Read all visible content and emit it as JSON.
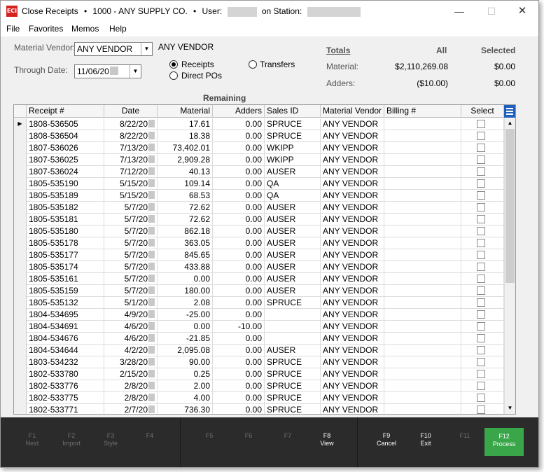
{
  "window": {
    "logo": "ECI",
    "title": "Close Receipts",
    "bullet": "•",
    "company": "1000 - ANY SUPPLY CO.",
    "user_label": "User:",
    "station_label": "on Station:",
    "min_glyph": "—",
    "max_glyph": "☐",
    "close_glyph": "✕"
  },
  "menu": [
    "File",
    "Favorites",
    "Memos",
    "Help"
  ],
  "filters": {
    "vendor_label": "Material Vendor:",
    "vendor_value": "ANY VENDOR",
    "vendor_name": "ANY VENDOR",
    "date_label": "Through Date:",
    "date_value": "11/06/20",
    "radios": [
      {
        "label": "Receipts",
        "checked": true
      },
      {
        "label": "Direct POs",
        "checked": false
      },
      {
        "label": "Transfers",
        "checked": false
      }
    ]
  },
  "totals": {
    "heading": "Totals",
    "col_all": "All",
    "col_selected": "Selected",
    "rows": [
      {
        "label": "Material:",
        "all": "$2,110,269.08",
        "selected": "$0.00"
      },
      {
        "label": "Adders:",
        "all": "($10.00)",
        "selected": "$0.00"
      }
    ]
  },
  "grid": {
    "group_header": "Remaining",
    "columns": [
      "Receipt #",
      "Date",
      "Material",
      "Adders",
      "Sales ID",
      "Material Vendor",
      "Billing #",
      "Select"
    ],
    "current_row_marker": "▶",
    "scroll_up": "▲",
    "scroll_down": "▼",
    "rows": [
      {
        "receipt": "1808-536505",
        "date": "8/22/20",
        "material": "17.61",
        "adders": "0.00",
        "sales_id": "SPRUCE",
        "vendor": "ANY VENDOR",
        "billing": ""
      },
      {
        "receipt": "1808-536504",
        "date": "8/22/20",
        "material": "18.38",
        "adders": "0.00",
        "sales_id": "SPRUCE",
        "vendor": "ANY VENDOR",
        "billing": ""
      },
      {
        "receipt": "1807-536026",
        "date": "7/13/20",
        "material": "73,402.01",
        "adders": "0.00",
        "sales_id": "WKIPP",
        "vendor": "ANY VENDOR",
        "billing": ""
      },
      {
        "receipt": "1807-536025",
        "date": "7/13/20",
        "material": "2,909.28",
        "adders": "0.00",
        "sales_id": "WKIPP",
        "vendor": "ANY VENDOR",
        "billing": ""
      },
      {
        "receipt": "1807-536024",
        "date": "7/12/20",
        "material": "40.13",
        "adders": "0.00",
        "sales_id": "AUSER",
        "vendor": "ANY VENDOR",
        "billing": ""
      },
      {
        "receipt": "1805-535190",
        "date": "5/15/20",
        "material": "109.14",
        "adders": "0.00",
        "sales_id": "QA",
        "vendor": "ANY VENDOR",
        "billing": ""
      },
      {
        "receipt": "1805-535189",
        "date": "5/15/20",
        "material": "68.53",
        "adders": "0.00",
        "sales_id": "QA",
        "vendor": "ANY VENDOR",
        "billing": ""
      },
      {
        "receipt": "1805-535182",
        "date": "5/7/20",
        "material": "72.62",
        "adders": "0.00",
        "sales_id": "AUSER",
        "vendor": "ANY VENDOR",
        "billing": ""
      },
      {
        "receipt": "1805-535181",
        "date": "5/7/20",
        "material": "72.62",
        "adders": "0.00",
        "sales_id": "AUSER",
        "vendor": "ANY VENDOR",
        "billing": ""
      },
      {
        "receipt": "1805-535180",
        "date": "5/7/20",
        "material": "862.18",
        "adders": "0.00",
        "sales_id": "AUSER",
        "vendor": "ANY VENDOR",
        "billing": ""
      },
      {
        "receipt": "1805-535178",
        "date": "5/7/20",
        "material": "363.05",
        "adders": "0.00",
        "sales_id": "AUSER",
        "vendor": "ANY VENDOR",
        "billing": ""
      },
      {
        "receipt": "1805-535177",
        "date": "5/7/20",
        "material": "845.65",
        "adders": "0.00",
        "sales_id": "AUSER",
        "vendor": "ANY VENDOR",
        "billing": ""
      },
      {
        "receipt": "1805-535174",
        "date": "5/7/20",
        "material": "433.88",
        "adders": "0.00",
        "sales_id": "AUSER",
        "vendor": "ANY VENDOR",
        "billing": ""
      },
      {
        "receipt": "1805-535161",
        "date": "5/7/20",
        "material": "0.00",
        "adders": "0.00",
        "sales_id": "AUSER",
        "vendor": "ANY VENDOR",
        "billing": ""
      },
      {
        "receipt": "1805-535159",
        "date": "5/7/20",
        "material": "180.00",
        "adders": "0.00",
        "sales_id": "AUSER",
        "vendor": "ANY VENDOR",
        "billing": ""
      },
      {
        "receipt": "1805-535132",
        "date": "5/1/20",
        "material": "2.08",
        "adders": "0.00",
        "sales_id": "SPRUCE",
        "vendor": "ANY VENDOR",
        "billing": ""
      },
      {
        "receipt": "1804-534695",
        "date": "4/9/20",
        "material": "-25.00",
        "adders": "0.00",
        "sales_id": "",
        "vendor": "ANY VENDOR",
        "billing": ""
      },
      {
        "receipt": "1804-534691",
        "date": "4/6/20",
        "material": "0.00",
        "adders": "-10.00",
        "sales_id": "",
        "vendor": "ANY VENDOR",
        "billing": ""
      },
      {
        "receipt": "1804-534676",
        "date": "4/6/20",
        "material": "-21.85",
        "adders": "0.00",
        "sales_id": "",
        "vendor": "ANY VENDOR",
        "billing": ""
      },
      {
        "receipt": "1804-534644",
        "date": "4/2/20",
        "material": "2,095.08",
        "adders": "0.00",
        "sales_id": "AUSER",
        "vendor": "ANY VENDOR",
        "billing": ""
      },
      {
        "receipt": "1803-534232",
        "date": "3/28/20",
        "material": "90.00",
        "adders": "0.00",
        "sales_id": "SPRUCE",
        "vendor": "ANY VENDOR",
        "billing": ""
      },
      {
        "receipt": "1802-533780",
        "date": "2/15/20",
        "material": "0.25",
        "adders": "0.00",
        "sales_id": "SPRUCE",
        "vendor": "ANY VENDOR",
        "billing": ""
      },
      {
        "receipt": "1802-533776",
        "date": "2/8/20",
        "material": "2.00",
        "adders": "0.00",
        "sales_id": "SPRUCE",
        "vendor": "ANY VENDOR",
        "billing": ""
      },
      {
        "receipt": "1802-533775",
        "date": "2/8/20",
        "material": "4.00",
        "adders": "0.00",
        "sales_id": "SPRUCE",
        "vendor": "ANY VENDOR",
        "billing": ""
      },
      {
        "receipt": "1802-533771",
        "date": "2/7/20",
        "material": "736.30",
        "adders": "0.00",
        "sales_id": "SPRUCE",
        "vendor": "ANY VENDOR",
        "billing": ""
      }
    ]
  },
  "function_keys": [
    {
      "key": "F1",
      "label": "Next",
      "enabled": false
    },
    {
      "key": "F2",
      "label": "Import",
      "enabled": false
    },
    {
      "key": "F3",
      "label": "Style",
      "enabled": false
    },
    {
      "key": "F4",
      "label": "",
      "enabled": false
    },
    {
      "key": "F5",
      "label": "",
      "enabled": false
    },
    {
      "key": "F6",
      "label": "",
      "enabled": false
    },
    {
      "key": "F7",
      "label": "",
      "enabled": false
    },
    {
      "key": "F8",
      "label": "View",
      "enabled": true
    },
    {
      "key": "F9",
      "label": "Cancel",
      "enabled": true
    },
    {
      "key": "F10",
      "label": "Exit",
      "enabled": true
    },
    {
      "key": "F11",
      "label": "",
      "enabled": false
    },
    {
      "key": "F12",
      "label": "Process",
      "enabled": true,
      "primary": true
    }
  ],
  "colors": {
    "process_button": "#3aa64a",
    "grid_menu_button": "#1f5fc0",
    "function_bar": "#2b2b2b"
  }
}
